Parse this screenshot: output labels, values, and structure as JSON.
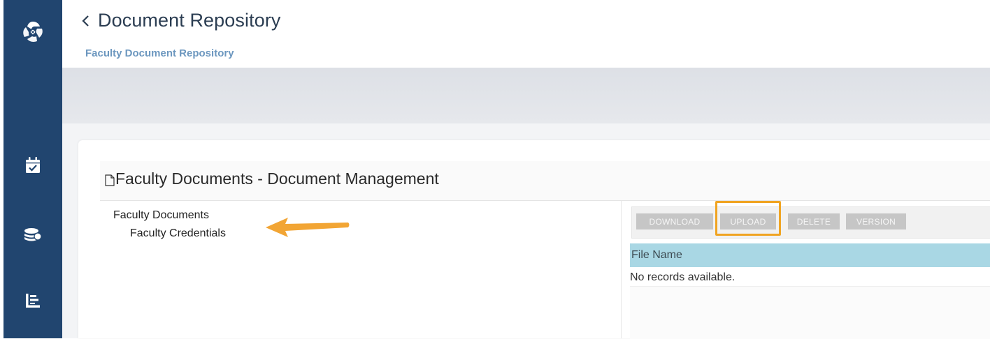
{
  "header": {
    "title": "Document Repository",
    "breadcrumb": "Faculty Document Repository"
  },
  "rail": {
    "icons": [
      "app-logo-icon",
      "calendar-check-icon",
      "coins-icon",
      "chart-list-icon"
    ]
  },
  "panel": {
    "title": "Faculty Documents - Document Management"
  },
  "tree": {
    "root": "Faculty Documents",
    "child": "Faculty Credentials"
  },
  "toolbar": {
    "download_label": "DOWNLOAD",
    "upload_label": "UPLOAD",
    "delete_label": "DELETE",
    "version_label": "VERSION"
  },
  "grid": {
    "columns": [
      "File Name"
    ],
    "empty_message": "No records available."
  },
  "colors": {
    "rail": "#21456f",
    "highlight": "#f0a422",
    "grid_header": "#a9d7e4",
    "breadcrumb": "#6c97bf"
  }
}
